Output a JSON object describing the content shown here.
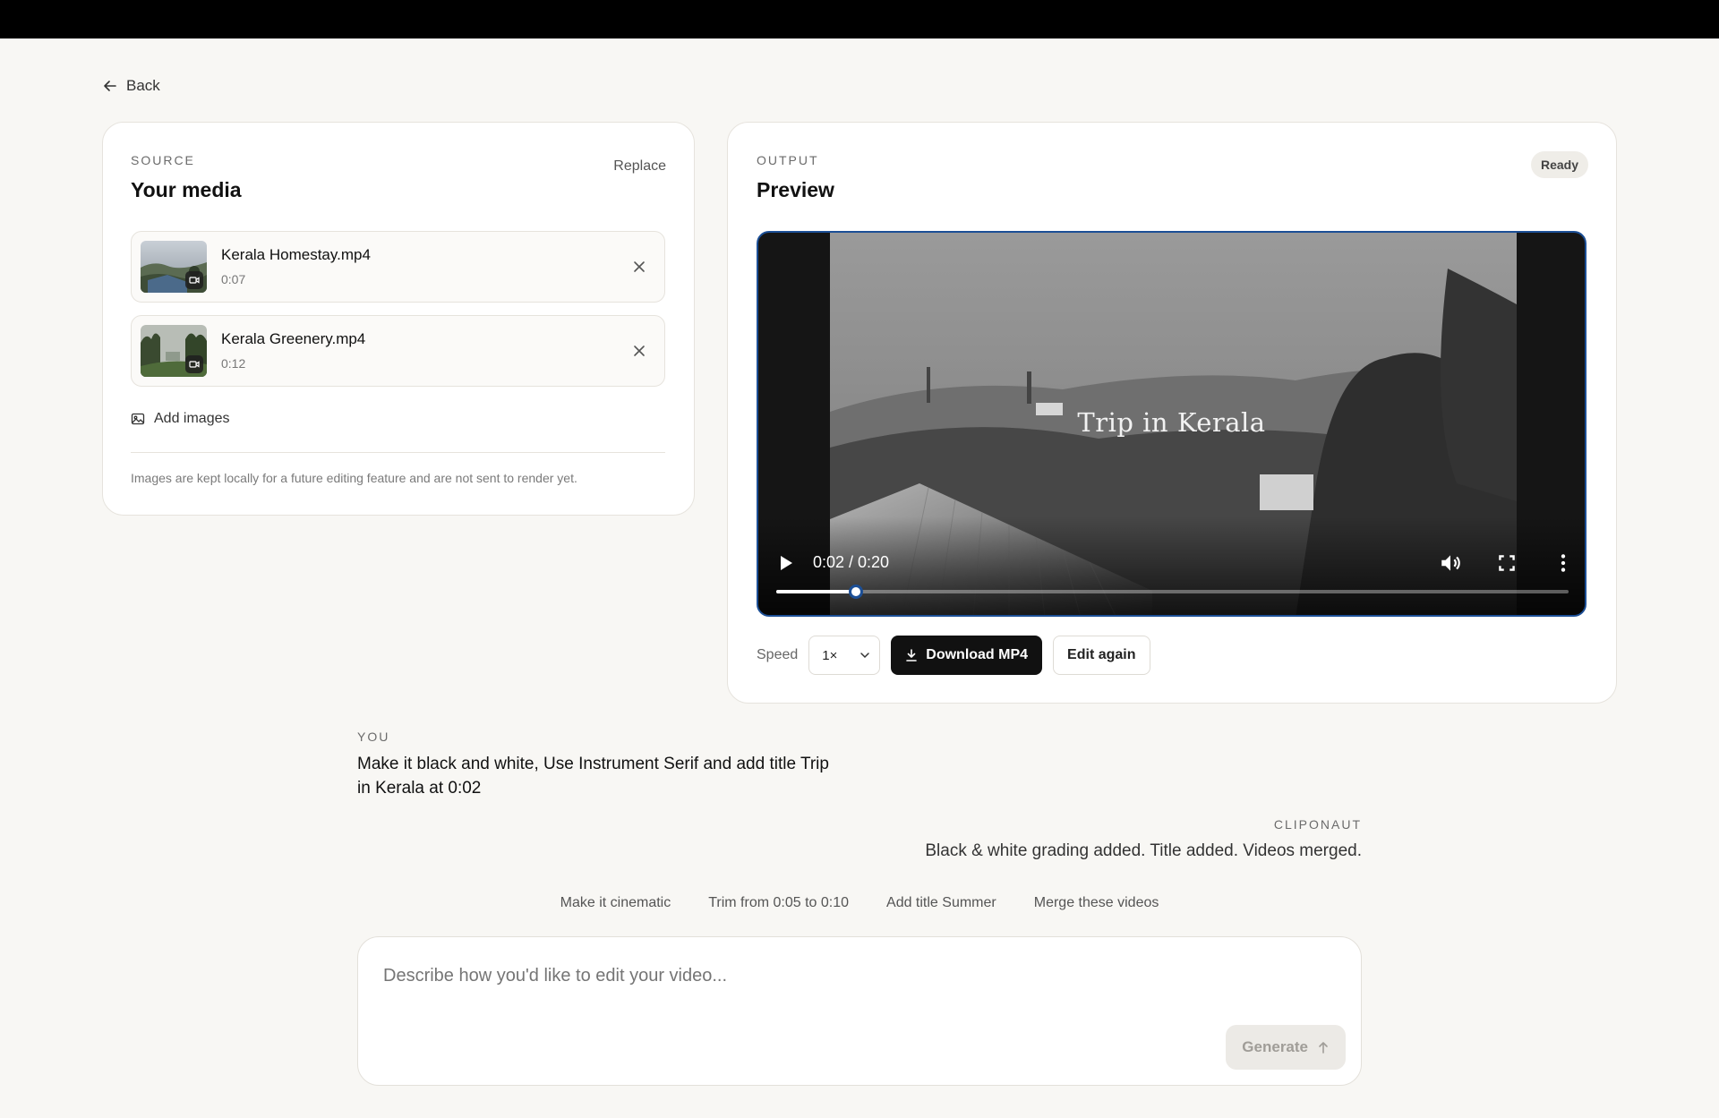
{
  "nav": {
    "back_label": "Back"
  },
  "source": {
    "eyebrow": "SOURCE",
    "title": "Your media",
    "replace_label": "Replace",
    "items": [
      {
        "name": "Kerala Homestay.mp4",
        "duration": "0:07"
      },
      {
        "name": "Kerala Greenery.mp4",
        "duration": "0:12"
      }
    ],
    "add_images_label": "Add images",
    "note": "Images are kept locally for a future editing feature and are not sent to render yet."
  },
  "output": {
    "eyebrow": "OUTPUT",
    "title": "Preview",
    "status": "Ready",
    "video": {
      "overlay_title": "Trip in Kerala",
      "time": "0:02 / 0:20",
      "progress": 0.1
    },
    "speed_label": "Speed",
    "speed_value": "1×",
    "download_label": "Download MP4",
    "edit_again_label": "Edit again"
  },
  "chat": {
    "user_label": "YOU",
    "user_message": "Make it black and white, Use Instrument Serif and add title Trip in Kerala at 0:02",
    "bot_label": "CLIPONAUT",
    "bot_message": "Black & white grading added. Title added. Videos merged."
  },
  "suggestions": [
    "Make it cinematic",
    "Trim from 0:05 to 0:10",
    "Add title Summer",
    "Merge these videos"
  ],
  "composer": {
    "placeholder": "Describe how you'd like to edit your video...",
    "generate_label": "Generate"
  }
}
